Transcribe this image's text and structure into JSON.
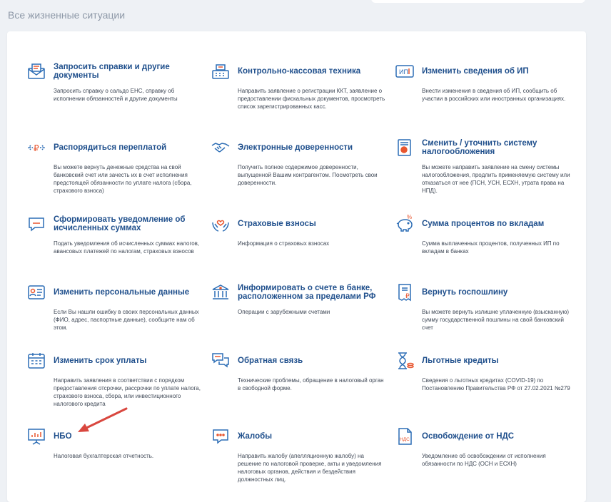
{
  "section_title": "Все жизненные ситуации",
  "tiles": [
    {
      "title": "Запросить справки и другие документы",
      "desc": "Запросить справку о сальдо ЕНС, справку об исполнении обязанностей и другие документы",
      "icon": "envelope-document-icon"
    },
    {
      "title": "Контрольно-кассовая техника",
      "desc": "Направить заявление о регистрации ККТ, заявление о предоставлении фискальных документов, просмотреть список зарегистрированных касс.",
      "icon": "cash-register-icon"
    },
    {
      "title": "Изменить сведения об ИП",
      "desc": "Внести изменения в сведения об ИП, сообщить об участии в российских или иностранных организациях.",
      "icon": "ip-card-icon"
    },
    {
      "title": "Распорядиться переплатой",
      "desc": "Вы можете вернуть денежные средства на свой банковский счет или зачесть их в счет исполнения предстоящей обязанности по уплате налога (сбора, страхового взноса)",
      "icon": "ruble-arrows-icon"
    },
    {
      "title": "Электронные доверенности",
      "desc": "Получить полное содержимое доверенности, выпущенной Вашим контрагентом. Посмотреть свои доверенности.",
      "icon": "handshake-icon"
    },
    {
      "title": "Сменить / уточнить систему налогообложения",
      "desc": "Вы можете направить заявление на смену системы налогообложения, продлить применяемую систему или отказаться от нее (ПСН, УСН, ЕСХН, утрата права на НПД).",
      "icon": "document-seal-icon"
    },
    {
      "title": "Сформировать уведомление об исчисленных суммах",
      "desc": "Подать уведомления об исчисленных суммах налогов, авансовых платежей по налогам, страховых взносов",
      "icon": "notification-envelope-icon"
    },
    {
      "title": "Страховые взносы",
      "desc": "Информация о страховых взносах",
      "icon": "hands-heart-icon"
    },
    {
      "title": "Сумма процентов по вкладам",
      "desc": "Сумма выплаченных процентов, полученных ИП по вкладам в банках",
      "icon": "piggy-bank-icon"
    },
    {
      "title": "Изменить персональные данные",
      "desc": "Если Вы нашли ошибку в своих персональных данных (ФИО, адрес, паспортные данные), сообщите нам об этом.",
      "icon": "id-card-icon"
    },
    {
      "title": "Информировать о счете в банке, расположенном за пределами РФ",
      "desc": "Операции с зарубежными счетами",
      "icon": "bank-building-icon"
    },
    {
      "title": "Вернуть госпошлину",
      "desc": "Вы можете вернуть излишне уплаченную (взысканную) сумму государственной пошлины на свой банковский счет",
      "icon": "receipt-ruble-icon"
    },
    {
      "title": "Изменить срок уплаты",
      "desc": "Направить заявления в соответствии с порядком предоставления отсрочки, рассрочки по уплате налога, страхового взноса, сбора, или инвестиционного налогового кредита",
      "icon": "calendar-icon"
    },
    {
      "title": "Обратная связь",
      "desc": "Технические проблемы, обращение в налоговый орган в свободной форме.",
      "icon": "chat-bubbles-icon"
    },
    {
      "title": "Льготные кредиты",
      "desc": "Сведения о льготных кредитах (COVID-19) по Постановлению Правительства РФ от 27.02.2021 №279",
      "icon": "hourglass-coins-icon"
    },
    {
      "title": "НБО",
      "desc": "Налоговая бухгалтерская отчетность.",
      "icon": "presentation-board-icon"
    },
    {
      "title": "Жалобы",
      "desc": "Направить жалобу (апелляционную жалобу) на решение по налоговой проверке, акты и уведомления налоговых органов, действия и бездействия должностных лиц.",
      "icon": "complaint-chat-icon"
    },
    {
      "title": "Освобождение от НДС",
      "desc": "Уведомление об освобождении от исполнения обязанности по НДС (ОСН и ЕСХН)",
      "icon": "vat-document-icon"
    }
  ],
  "icon_text": {
    "ip": "ИП",
    "nds": "НДС",
    "ruble": "₽",
    "percent": "%"
  },
  "colors": {
    "title": "#1f4f8c",
    "icon": "#2c6db5",
    "accent": "#e8562f",
    "arrow": "#d9473f"
  }
}
